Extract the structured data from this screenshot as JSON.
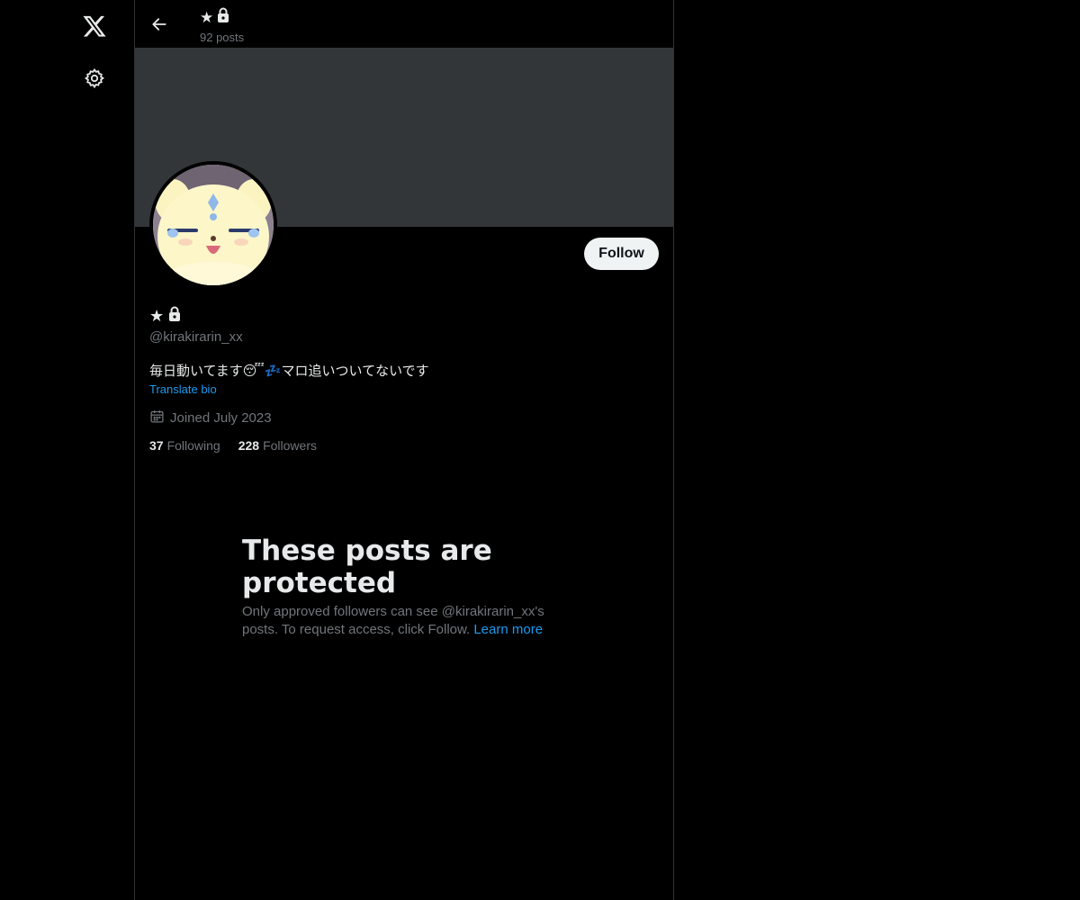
{
  "nav": {
    "logo_icon": "x-logo-icon",
    "settings_icon": "gear-icon"
  },
  "header": {
    "display_name": "★",
    "lock_icon": "lock-icon",
    "posts_count": "92 posts",
    "back_icon": "arrow-left-icon"
  },
  "profile": {
    "banner_color": "#333639",
    "follow_label": "Follow",
    "display_name": "★",
    "handle": "@kirakirarin_xx",
    "bio": "毎日動いてます😴💤マロ追いついてないです",
    "translate_label": "Translate bio",
    "joined": "Joined July 2023",
    "following_count": "37",
    "following_label": "Following",
    "followers_count": "228",
    "followers_label": "Followers"
  },
  "protected": {
    "title": "These posts are protected",
    "text": "Only approved followers can see @kirakirarin_xx's posts. To request access, click Follow.",
    "learn_more": "Learn more"
  },
  "colors": {
    "background": "#000000",
    "accent": "#1d9bf0",
    "text_primary": "#e7e9ea",
    "text_secondary": "#71767b",
    "border": "#2f3336"
  }
}
